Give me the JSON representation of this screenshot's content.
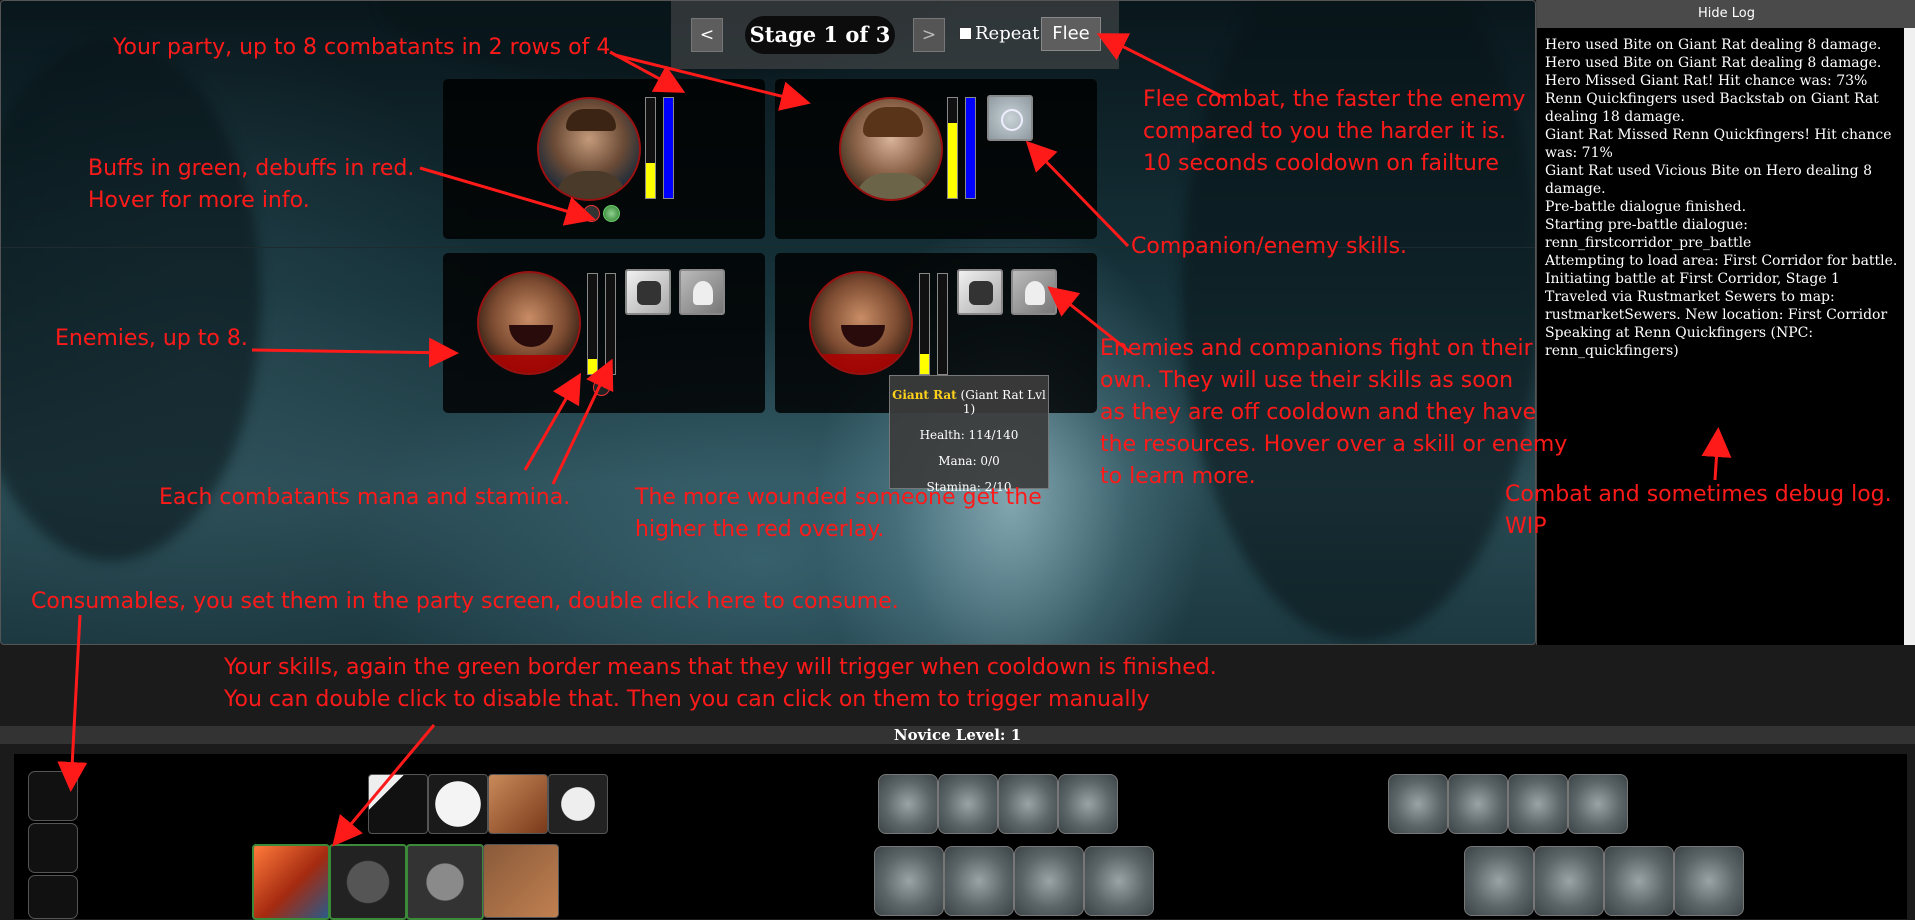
{
  "stage": {
    "prev": "<",
    "label": "Stage 1 of 3",
    "next": ">",
    "repeat": "Repeat",
    "flee": "Flee"
  },
  "annotations": {
    "party": "Your party, up to 8 combatants in 2 rows of 4",
    "buffs1": "Buffs in green, debuffs in red.",
    "buffs2": "Hover for more info.",
    "flee1": "Flee combat, the faster the enemy",
    "flee2": "compared to you the harder it is.",
    "flee3": "10 seconds cooldown on failture",
    "companion": "Companion/enemy skills.",
    "enemies": "Enemies, up to 8.",
    "fight1": "Enemies and companions fight on their",
    "fight2": " own. They will use their skills as soon",
    "fight3": "as they are off cooldown and they have",
    "fight4": "the resources. Hover over a skill or enemy",
    "fight5": "to learn more.",
    "mana": "Each combatants mana and stamina.",
    "wounded1": "The more wounded someone get the",
    "wounded2": "higher the red overlay.",
    "log1": "Combat and sometimes debug log.",
    "log2": "WIP",
    "consumables": "Consumables, you set them in the party screen, double click here to consume.",
    "skills1": "Your skills, again the green border means that they will trigger when cooldown is finished.",
    "skills2": "You can double click to disable that. Then you can click on them to trigger manually"
  },
  "tooltip": {
    "name": "Giant Rat",
    "detail": " (Giant Rat Lvl 1)",
    "health": "Health: 114/140",
    "mana": "Mana: 0/0",
    "stamina": "Stamina: 2/10"
  },
  "log": {
    "hide": "Hide Log",
    "lines": [
      "Hero used Bite on Giant Rat dealing 8 damage.",
      "Hero used Bite on Giant Rat dealing 8 damage.",
      "Hero Missed Giant Rat! Hit chance was: 73%",
      "Renn Quickfingers used Backstab on Giant Rat dealing 18 damage.",
      "Giant Rat Missed Renn Quickfingers! Hit chance was: 71%",
      "Giant Rat used Vicious Bite on Hero dealing 8 damage.",
      "Pre-battle dialogue finished.",
      "Starting pre-battle dialogue: renn_firstcorridor_pre_battle",
      "Attempting to load area: First Corridor for battle.",
      "Initiating battle at First Corridor, Stage 1",
      "Traveled via Rustmarket Sewers to map: rustmarketSewers. New location: First Corridor",
      "Speaking at Renn Quickfingers (NPC: renn_quickfingers)"
    ]
  },
  "level": "Novice Level: 1",
  "combatants": {
    "hero": {
      "stamina": 0.35,
      "mana": 1.0
    },
    "renn": {
      "stamina": 0.75,
      "mana": 1.0
    },
    "rat1": {
      "stamina": 0.15,
      "mana": 0.0,
      "wound": 0.18
    },
    "rat2": {
      "stamina": 0.2,
      "mana": 0.0,
      "wound": 0.19
    }
  },
  "colors": {
    "annotation": "#ff1a1a",
    "stamina": "#ffff00",
    "mana": "#0000ff",
    "wound": "#b00000"
  }
}
